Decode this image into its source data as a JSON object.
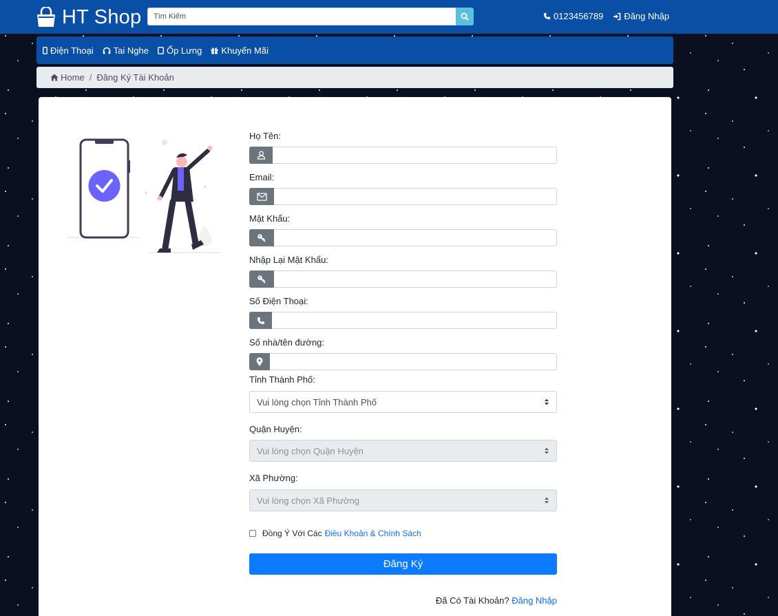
{
  "header": {
    "logo_text": "HT Shop",
    "search_placeholder": "Tìm Kiếm",
    "phone": "0123456789",
    "login": "Đăng Nhập"
  },
  "nav": {
    "items": [
      {
        "label": "Điện Thoại",
        "icon": "mobile-icon"
      },
      {
        "label": "Tai Nghe",
        "icon": "headphones-icon"
      },
      {
        "label": "Ốp Lưng",
        "icon": "tablet-icon"
      },
      {
        "label": "Khuyến Mãi",
        "icon": "gift-icon"
      }
    ]
  },
  "breadcrumb": {
    "home": "Home",
    "current": "Đăng Ký Tài Khoản"
  },
  "form": {
    "fields": [
      {
        "label": "Họ Tên:",
        "icon": "user-icon",
        "value": ""
      },
      {
        "label": "Email:",
        "icon": "envelope-icon",
        "value": ""
      },
      {
        "label": "Mật Khẩu:",
        "icon": "key-icon",
        "value": ""
      },
      {
        "label": "Nhập Lại Mật Khẩu:",
        "icon": "key-icon",
        "value": ""
      },
      {
        "label": "Số Điện Thoại:",
        "icon": "phone-icon",
        "value": ""
      },
      {
        "label": "Số nhà/tên đường:",
        "icon": "map-marker-icon",
        "value": ""
      }
    ],
    "selects": [
      {
        "label": "Tỉnh Thành Phố:",
        "value": "Vui lòng chọn Tỉnh Thành Phố",
        "disabled": false
      },
      {
        "label": "Quận Huyện:",
        "value": "Vui lòng chọn Quận Huyện",
        "disabled": true
      },
      {
        "label": "Xã Phường:",
        "value": "Vui lòng chọn Xã Phường",
        "disabled": true
      }
    ],
    "agree_text": "Đồng Ý Với Các",
    "agree_link": "Điều Khoản & Chính Sách",
    "agree_checked": false,
    "submit_label": "Đăng Ký",
    "have_account_text": "Đã Có Tài Khoản?",
    "login_link": "Đăng Nhập"
  },
  "colors": {
    "brand": "#0a4fa6",
    "primary_button": "#0d7bff",
    "link": "#0d6efd",
    "addon": "#6c757d",
    "illustration_accent": "#6c63ff"
  }
}
